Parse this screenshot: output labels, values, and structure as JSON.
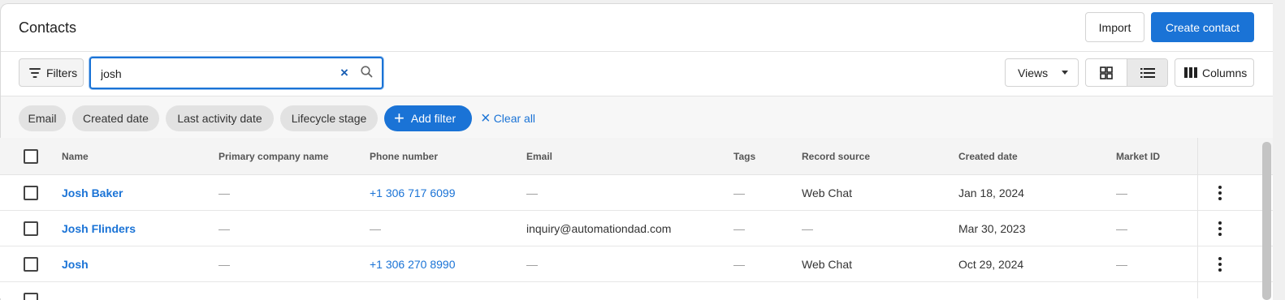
{
  "header": {
    "title": "Contacts",
    "import_label": "Import",
    "create_label": "Create contact"
  },
  "toolbar": {
    "filters_label": "Filters",
    "search_value": "josh",
    "views_label": "Views",
    "columns_label": "Columns"
  },
  "chips": [
    "Email",
    "Created date",
    "Last activity date",
    "Lifecycle stage"
  ],
  "add_filter_label": "Add filter",
  "clear_all_label": "Clear all",
  "table": {
    "columns": [
      "Name",
      "Primary company name",
      "Phone number",
      "Email",
      "Tags",
      "Record source",
      "Created date",
      "Market ID"
    ],
    "rows": [
      {
        "name": "Josh Baker",
        "company": "—",
        "phone": "+1 306 717 6099",
        "email": "—",
        "tags": "—",
        "source": "Web Chat",
        "created": "Jan 18, 2024",
        "market": "—"
      },
      {
        "name": "Josh Flinders",
        "company": "—",
        "phone": "—",
        "email": "inquiry@automationdad.com",
        "tags": "—",
        "source": "—",
        "created": "Mar 30, 2023",
        "market": "—"
      },
      {
        "name": "Josh",
        "company": "—",
        "phone": "+1 306 270 8990",
        "email": "—",
        "tags": "—",
        "source": "Web Chat",
        "created": "Oct 29, 2024",
        "market": "—"
      }
    ]
  },
  "colors": {
    "primary": "#1a73d6",
    "link": "#1a73d6"
  }
}
